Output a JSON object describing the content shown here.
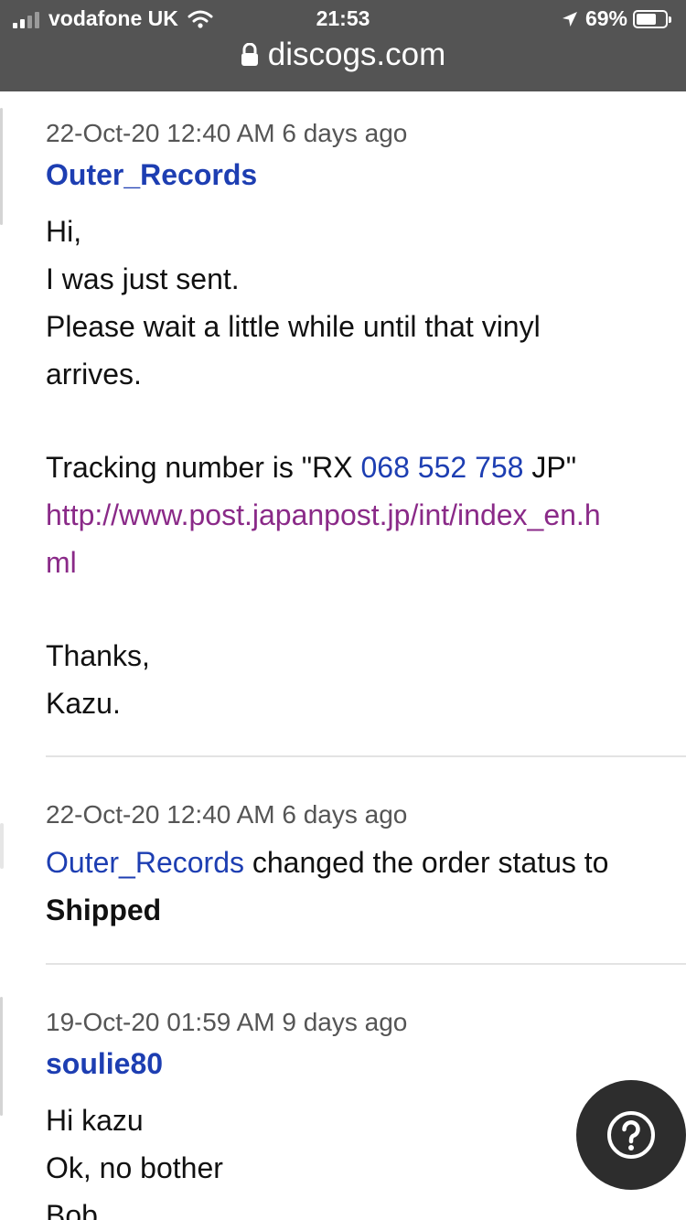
{
  "status_bar": {
    "carrier": "vodafone UK",
    "time": "21:53",
    "battery": "69%",
    "battery_level": 0.69,
    "signal_bars": 2,
    "url": "discogs.com"
  },
  "messages": [
    {
      "meta": "22-Oct-20 12:40 AM 6 days ago",
      "author": "Outer_Records",
      "lines": [
        "Hi,",
        "I was just sent.",
        "Please wait a little while until that vinyl",
        "arrives."
      ],
      "tracking_prefix": "Tracking number is \"RX ",
      "tracking_number": "068 552 758",
      "tracking_suffix": " JP\"",
      "url_line1": "http://www.post.japanpost.jp/int/index_en.h",
      "url_line2": "ml",
      "closing": [
        "Thanks,",
        "Kazu."
      ]
    },
    {
      "meta": "22-Oct-20 12:40 AM 6 days ago",
      "author": "Outer_Records",
      "action_text": " changed the order status to",
      "status": "Shipped"
    },
    {
      "meta": "19-Oct-20 01:59 AM 9 days ago",
      "author": "soulie80",
      "lines": [
        "Hi kazu",
        "Ok, no bother",
        "Bob"
      ]
    }
  ],
  "help_button": {
    "icon": "question-mark-icon"
  }
}
